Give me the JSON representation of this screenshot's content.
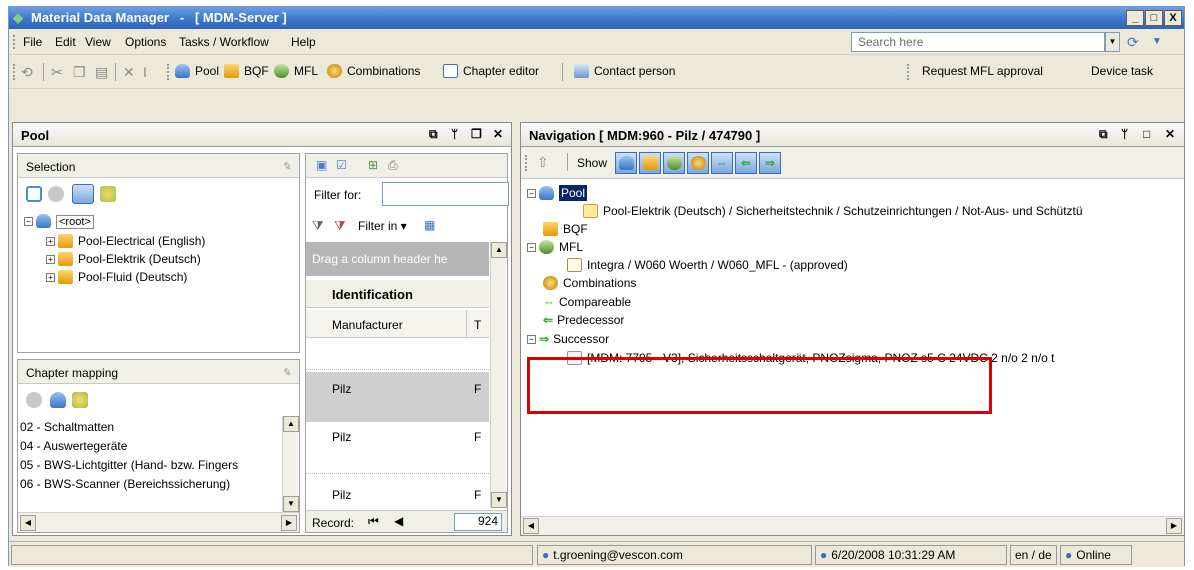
{
  "window": {
    "title": "Material Data Manager   -   [ MDM-Server ]",
    "minimize": "_",
    "maximize": "□",
    "close": "X"
  },
  "menu": [
    "File",
    "Edit",
    "View",
    "Options",
    "Tasks / Workflow",
    "Help"
  ],
  "search": {
    "placeholder": "Search here"
  },
  "toolbar": {
    "pool": "Pool",
    "bqf": "BQF",
    "mfl": "MFL",
    "combinations": "Combinations",
    "chapter_editor": "Chapter editor",
    "contact_person": "Contact person",
    "request_mfl": "Request MFL approval",
    "device_task": "Device task"
  },
  "pool_panel": {
    "title": "Pool",
    "selection": {
      "header": "Selection",
      "root": "<root>",
      "items": [
        "Pool-Electrical (English)",
        "Pool-Elektrik (Deutsch)",
        "Pool-Fluid (Deutsch)"
      ]
    },
    "chapter_mapping": {
      "header": "Chapter mapping",
      "items": [
        "02 - Schaltmatten",
        "04 - Auswertegeräte",
        "05 - BWS-Lichtgitter (Hand- bzw. Fingers",
        "06 - BWS-Scanner (Bereichssicherung)"
      ]
    },
    "grid": {
      "filter_label": "Filter for:",
      "filter_in": "Filter in",
      "group_hint": "Drag a column header he",
      "band": "Identification",
      "column": "Manufacturer",
      "column2": "T",
      "rows": [
        "Pilz",
        "Pilz",
        "Pilz"
      ],
      "row_t": [
        "F",
        "F",
        "F"
      ],
      "record_label": "Record:",
      "record_value": "924"
    }
  },
  "nav_panel": {
    "title": "Navigation [ MDM:960 - Pilz / 474790 ]",
    "show": "Show",
    "tree": {
      "pool": "Pool",
      "pool_child": "Pool-Elektrik (Deutsch) / Sicherheitstechnik / Schutzeinrichtungen / Not-Aus- und Schütztü",
      "bqf": "BQF",
      "mfl": "MFL",
      "mfl_child": "Integra / W060 Woerth / W060_MFL - (approved)",
      "combinations": "Combinations",
      "compareable": "Compareable",
      "predecessor": "Predecessor",
      "successor": "Successor",
      "successor_child": "[MDM: 7795 - V3], Sicherheitsschaltgerät, PNOZsigma, PNOZ s5 C 24VDC 2 n/o 2 n/o t"
    }
  },
  "status": {
    "user": "t.groening@vescon.com",
    "datetime": "6/20/2008 10:31:29 AM",
    "lang": "en / de",
    "online": "Online"
  }
}
